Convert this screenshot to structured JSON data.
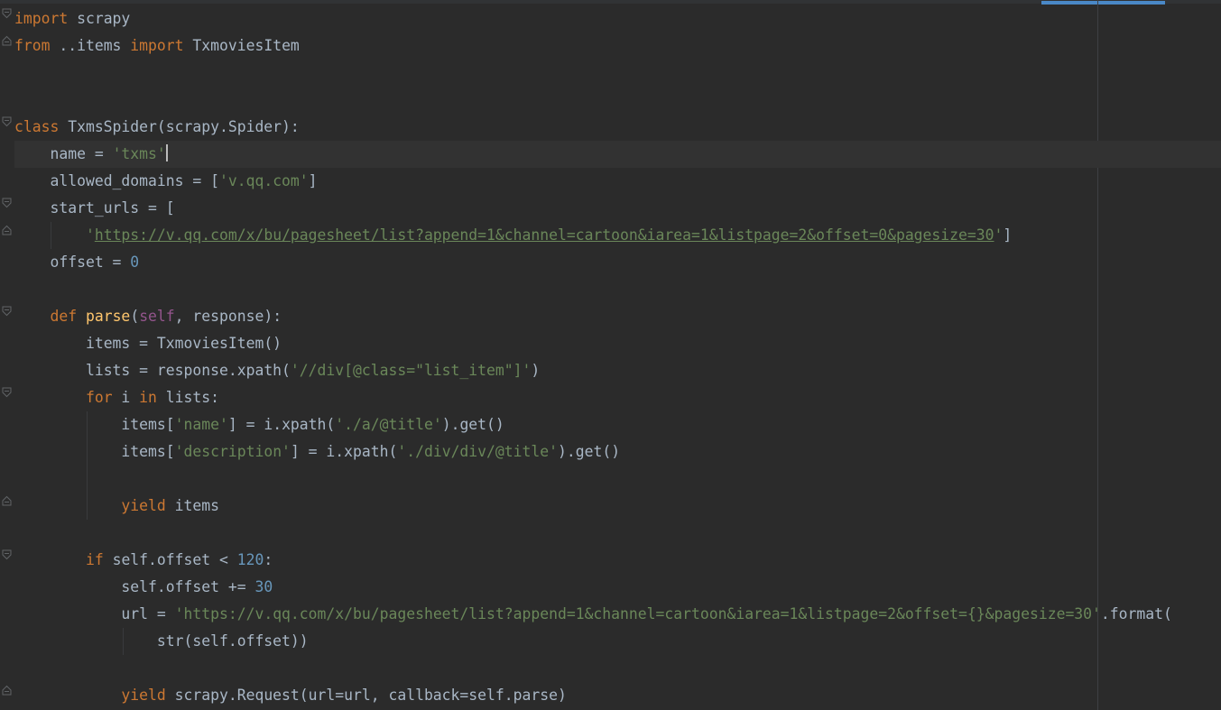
{
  "editor": {
    "language": "Python",
    "lines": {
      "l1": {
        "kw_import": "import",
        "module": " scrapy"
      },
      "l2": {
        "kw_from": "from",
        "pkg": " ..items ",
        "kw_import": "import",
        "name": " TxmoviesItem"
      },
      "l5": {
        "kw_class": "class",
        "decl": " TxmsSpider(scrapy.Spider):"
      },
      "l6": {
        "indent": "    ",
        "lhs": "name = ",
        "value": "'txms'"
      },
      "l7": {
        "indent": "    ",
        "lhs": "allowed_domains = [",
        "value": "'v.qq.com'",
        "end": "]"
      },
      "l8": {
        "indent": "    ",
        "text": "start_urls = ["
      },
      "l9": {
        "indent": "        ",
        "quote_open": "'",
        "url": "https://v.qq.com/x/bu/pagesheet/list?append=1&channel=cartoon&iarea=1&listpage=2&offset=0&pagesize=30",
        "quote_close": "'",
        "end": "]"
      },
      "l10": {
        "indent": "    ",
        "lhs": "offset = ",
        "value": "0"
      },
      "l12": {
        "indent": "    ",
        "kw_def": "def",
        "fn_name": " parse",
        "open": "(",
        "self": "self",
        "rest": ", response):"
      },
      "l13": {
        "indent": "        ",
        "text": "items = TxmoviesItem()"
      },
      "l14": {
        "indent": "        ",
        "lhs": "lists = response.xpath(",
        "value": "'//div[@class=\"list_item\"]'",
        "end": ")"
      },
      "l15": {
        "indent": "        ",
        "kw_for": "for",
        "mid": " i ",
        "kw_in": "in",
        "rest": " lists:"
      },
      "l16": {
        "indent": "            ",
        "a": "items[",
        "key": "'name'",
        "b": "] = i.xpath(",
        "value": "'./a/@title'",
        "end": ").get()"
      },
      "l17": {
        "indent": "            ",
        "a": "items[",
        "key": "'description'",
        "b": "] = i.xpath(",
        "value": "'./div/div/@title'",
        "end": ").get()"
      },
      "l19": {
        "indent": "            ",
        "kw_yield": "yield",
        "rest": " items"
      },
      "l21": {
        "indent": "        ",
        "kw_if": "if",
        "cond": " self.offset < ",
        "value": "120",
        "end": ":"
      },
      "l22": {
        "indent": "            ",
        "lhs": "self.offset += ",
        "value": "30"
      },
      "l23": {
        "indent": "            ",
        "lhs": "url = ",
        "value": "'https://v.qq.com/x/bu/pagesheet/list?append=1&channel=cartoon&iarea=1&listpage=2&offset={}&pagesize=30'",
        "end": ".format("
      },
      "l24": {
        "indent": "                ",
        "text": "str(self.offset))"
      },
      "l26": {
        "indent": "            ",
        "kw_yield": "yield",
        "rest": " scrapy.Request(url=url, callback=self.parse)"
      }
    }
  },
  "colors": {
    "background": "#2b2b2b",
    "keyword": "#cc7832",
    "string": "#6a8759",
    "number": "#6897bb",
    "self": "#94558d",
    "function": "#ffc66d",
    "text": "#a9b7c6",
    "scroll_indicator": "#4a88c7"
  }
}
